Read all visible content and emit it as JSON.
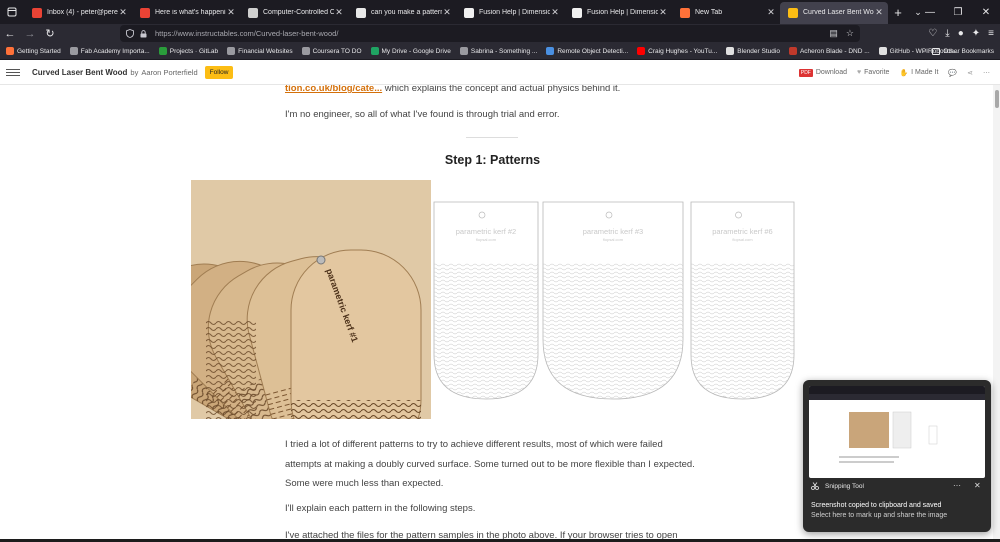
{
  "browser": {
    "tabs": [
      {
        "title": "Inbox (4) - peter@perezsnt",
        "icon_color": "#ea4335",
        "icon": "gmail-icon"
      },
      {
        "title": "Here is what's happening",
        "icon_color": "#ea4335",
        "icon": "gmail-icon"
      },
      {
        "title": "Computer-Controlled Cutt",
        "icon_color": "#cfcfcf",
        "icon": "document-icon"
      },
      {
        "title": "can you make a pattern in",
        "icon_color": "#e8e8e8",
        "icon": "search-icon"
      },
      {
        "title": "Fusion Help | Dimensions",
        "icon_color": "#f0f0f0",
        "icon": "fusion-icon"
      },
      {
        "title": "Fusion Help | Dimensions",
        "icon_color": "#f0f0f0",
        "icon": "fusion-icon"
      },
      {
        "title": "New Tab",
        "icon_color": "#ff7139",
        "icon": "firefox-icon"
      },
      {
        "title": "Curved Laser Bent Wood",
        "icon_color": "#fcbd14",
        "icon": "instructables-icon"
      }
    ],
    "url": "https://www.instructables.com/Curved-laser-bent-wood/",
    "bookmarks": [
      {
        "label": "Getting Started",
        "color": "#ff7139"
      },
      {
        "label": "Fab Academy Importa...",
        "color": "#9a9aa0"
      },
      {
        "label": "Projects · GitLab",
        "color": "#2a9d3b"
      },
      {
        "label": "Financial Websites",
        "color": "#9a9aa0"
      },
      {
        "label": "Coursera TO DO",
        "color": "#9a9aa0"
      },
      {
        "label": "My Drive - Google Drive",
        "color": "#1fa463"
      },
      {
        "label": "Sabrina - Something ...",
        "color": "#9a9aa0"
      },
      {
        "label": "Remote Object Detecti...",
        "color": "#4a90e2"
      },
      {
        "label": "Craig Hughes - YouTu...",
        "color": "#ff0000"
      },
      {
        "label": "Blender Studio",
        "color": "#e0e0e0"
      },
      {
        "label": "Acheron Blade - DND ...",
        "color": "#c0392b"
      },
      {
        "label": "GitHub - WPIRobotics...",
        "color": "#e0e0e0"
      }
    ],
    "other_bookmarks": "Other Bookmarks"
  },
  "site_header": {
    "title": "Curved Laser Bent Wood",
    "by": "by",
    "author": "Aaron Porterfield",
    "follow": "Follow",
    "download": "Download",
    "pdf_badge": "PDF",
    "favorite": "Favorite",
    "made_it": "I Made It"
  },
  "article": {
    "link_text": "tion.co.uk/blog/cate...",
    "intro_rest": " which explains the concept and actual physics behind it.",
    "para_engineer": "I'm no engineer, so all of what I've found is through trial and error.",
    "step_title": "Step 1: Patterns",
    "panels": [
      {
        "label": "parametric kerf #2",
        "sub": "flopsal.com"
      },
      {
        "label": "parametric kerf #3",
        "sub": "flopsal.com"
      },
      {
        "label": "parametric kerf #6",
        "sub": "flopsal.com"
      }
    ],
    "photo_label": "parametric kerf #1",
    "para_tried": "I tried a lot of different patterns to try to achieve different results, most of which were failed attempts at making a doubly curved surface. Some turned out to be more flexible than I expected. Some were much less than expected.",
    "para_explain": "I'll explain each pattern in the following steps.",
    "para_attached": "I've attached the files for the pattern samples in the photo above. If your browser tries to open"
  },
  "toast": {
    "app": "Snipping Tool",
    "title": "Screenshot copied to clipboard and saved",
    "sub": "Select here to mark up and share the image"
  }
}
